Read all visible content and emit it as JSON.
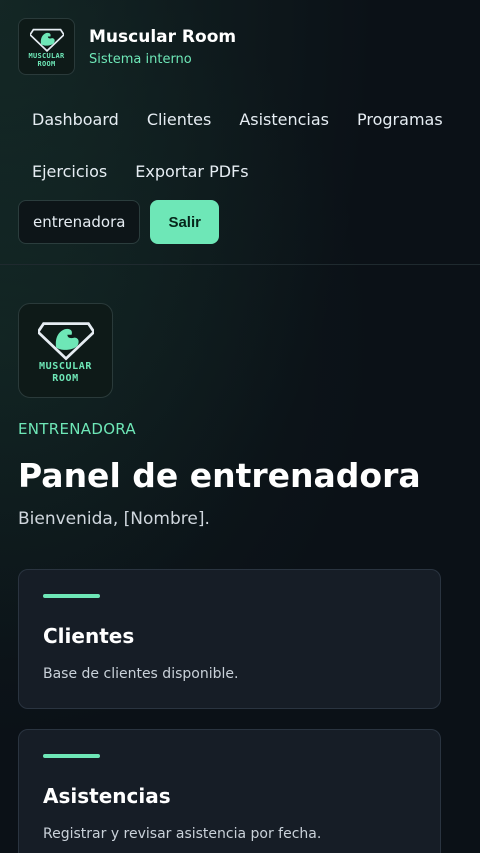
{
  "brand": {
    "name": "Muscular Room",
    "subtitle": "Sistema interno",
    "logo_text_line1": "MUSCULAR",
    "logo_text_line2": "ROOM",
    "logo_icon": "flexed-arm-diamond-icon"
  },
  "nav": {
    "items": [
      {
        "label": "Dashboard"
      },
      {
        "label": "Clientes"
      },
      {
        "label": "Asistencias"
      },
      {
        "label": "Programas"
      },
      {
        "label": "Ejercicios"
      },
      {
        "label": "Exportar PDFs"
      }
    ]
  },
  "actions": {
    "role_label": "entrenadora",
    "exit_label": "Salir"
  },
  "main": {
    "eyebrow": "ENTRENADORA",
    "title": "Panel de entrenadora",
    "welcome": "Bienvenida, [Nombre]."
  },
  "cards": [
    {
      "title": "Clientes",
      "description": "Base de clientes disponible."
    },
    {
      "title": "Asistencias",
      "description": "Registrar y revisar asistencia por fecha."
    }
  ],
  "colors": {
    "accent": "#6ee7b7",
    "background": "#0b1117",
    "card": "#161d26"
  }
}
